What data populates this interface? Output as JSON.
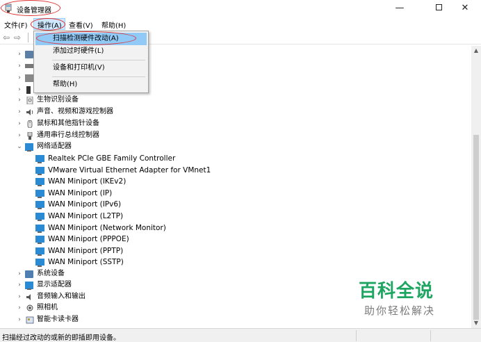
{
  "window": {
    "title": "设备管理器",
    "minimize": "—",
    "close": "✕"
  },
  "menubar": {
    "file": "文件(F)",
    "action": "操作(A)",
    "view": "查看(V)",
    "help": "帮助(H)"
  },
  "toolbar": {
    "back": "⇦",
    "forward": "⇨"
  },
  "action_menu": {
    "items": [
      {
        "label": "扫描检测硬件改动(A)"
      },
      {
        "label": "添加过时硬件(L)"
      },
      {
        "label": "设备和打印机(V)"
      },
      {
        "label": "帮助(H)"
      }
    ]
  },
  "tree": {
    "categories_top": [
      {
        "label": ""
      },
      {
        "label": ""
      },
      {
        "label": ""
      },
      {
        "label": ""
      },
      {
        "label": "生物识别设备"
      },
      {
        "label": "声音、视频和游戏控制器"
      },
      {
        "label": "鼠标和其他指针设备"
      },
      {
        "label": "通用串行总线控制器"
      }
    ],
    "network": {
      "label": "网络适配器",
      "children": [
        {
          "label": "Realtek PCIe GBE Family Controller"
        },
        {
          "label": "VMware Virtual Ethernet Adapter for VMnet1"
        },
        {
          "label": "WAN Miniport (IKEv2)"
        },
        {
          "label": "WAN Miniport (IP)"
        },
        {
          "label": "WAN Miniport (IPv6)"
        },
        {
          "label": "WAN Miniport (L2TP)"
        },
        {
          "label": "WAN Miniport (Network Monitor)"
        },
        {
          "label": "WAN Miniport (PPPOE)"
        },
        {
          "label": "WAN Miniport (PPTP)"
        },
        {
          "label": "WAN Miniport (SSTP)"
        }
      ]
    },
    "categories_bottom": [
      {
        "label": "系统设备"
      },
      {
        "label": "显示适配器"
      },
      {
        "label": "音频输入和输出"
      },
      {
        "label": "照相机"
      },
      {
        "label": "智能卡读卡器"
      }
    ],
    "collapsed_glyph": "›",
    "expanded_glyph": "⌄"
  },
  "status": {
    "text": "扫描经过改动的或新的即插即用设备。"
  },
  "watermark": {
    "title": "百科全说",
    "subtitle": "助你轻松解决"
  },
  "colors": {
    "highlight": "#91c9f7",
    "annotation_red": "#e03030",
    "watermark_green": "#1fa562"
  }
}
